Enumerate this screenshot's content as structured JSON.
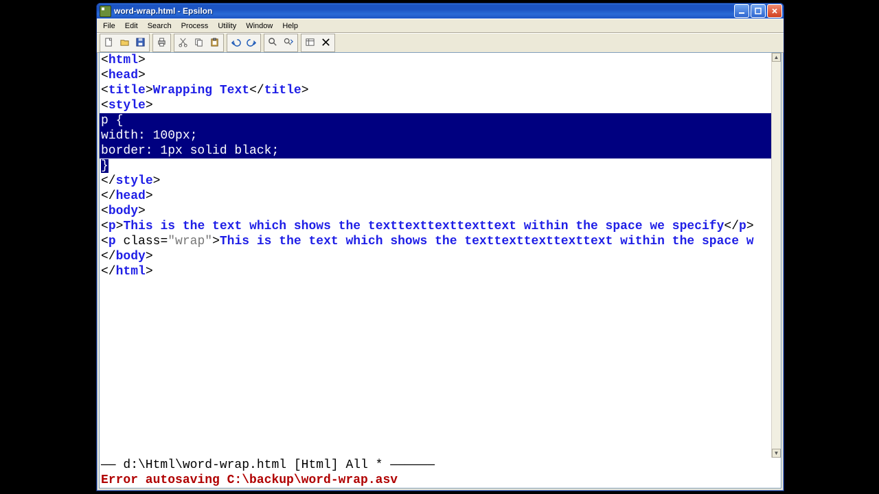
{
  "window": {
    "title": "word-wrap.html - Epsilon"
  },
  "menu": {
    "items": [
      "File",
      "Edit",
      "Search",
      "Process",
      "Utility",
      "Window",
      "Help"
    ]
  },
  "toolbar": {
    "groups": [
      [
        "new",
        "open",
        "save"
      ],
      [
        "print"
      ],
      [
        "cut",
        "copy",
        "paste"
      ],
      [
        "undo",
        "redo"
      ],
      [
        "find",
        "find-next"
      ],
      [
        "buffers",
        "close"
      ]
    ]
  },
  "code": {
    "lines": [
      {
        "type": "tag_open",
        "name": "html"
      },
      {
        "type": "tag_open",
        "name": "head"
      },
      {
        "type": "title",
        "content": "Wrapping Text"
      },
      {
        "type": "tag_open",
        "name": "style"
      },
      {
        "type": "sel",
        "text": "p {"
      },
      {
        "type": "sel",
        "text": "width: 100px;"
      },
      {
        "type": "sel",
        "text": "border: 1px solid black;"
      },
      {
        "type": "sel_partial",
        "text": "}"
      },
      {
        "type": "tag_close",
        "name": "style"
      },
      {
        "type": "tag_close",
        "name": "head"
      },
      {
        "type": "tag_open",
        "name": "body"
      },
      {
        "type": "p_plain",
        "content": "This is the text which shows the texttexttexttexttext within the space we specify"
      },
      {
        "type": "p_class",
        "class_value": "wrap",
        "content": "This is the text which shows the texttexttexttexttext within the space w"
      },
      {
        "type": "tag_close",
        "name": "body"
      },
      {
        "type": "tag_close",
        "name": "html"
      }
    ]
  },
  "status": {
    "mode_line_prefix": "—— ",
    "mode_line_text": "d:\\Html\\word-wrap.html [Html] All *",
    "mode_line_suffix": " ——————",
    "echo_text": "Error autosaving C:\\backup\\word-wrap.asv"
  }
}
